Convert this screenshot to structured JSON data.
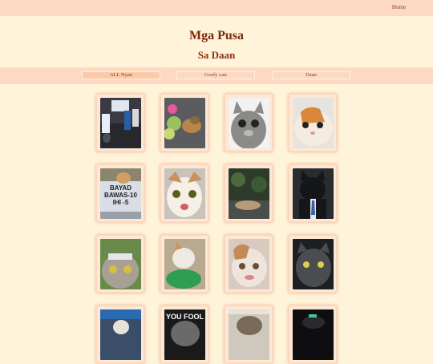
{
  "nav": {
    "home_label": "Home"
  },
  "header": {
    "title": "Mga Pusa",
    "subtitle": "Sa Daan"
  },
  "tabs": [
    {
      "label": "ALL Nyan",
      "active": true
    },
    {
      "label": "Goofy cats",
      "active": false
    },
    {
      "label": "Daan",
      "active": false
    }
  ],
  "gallery": {
    "sign_text": [
      "BAYAD",
      "BAWAS-10",
      "IHI -5"
    ],
    "meme_caption": "YOU FOOL"
  },
  "colors": {
    "background": "#fff3d9",
    "bar": "#fcd9c2",
    "accent_text": "#7a2a08",
    "card_border": "#fbd7bd"
  }
}
